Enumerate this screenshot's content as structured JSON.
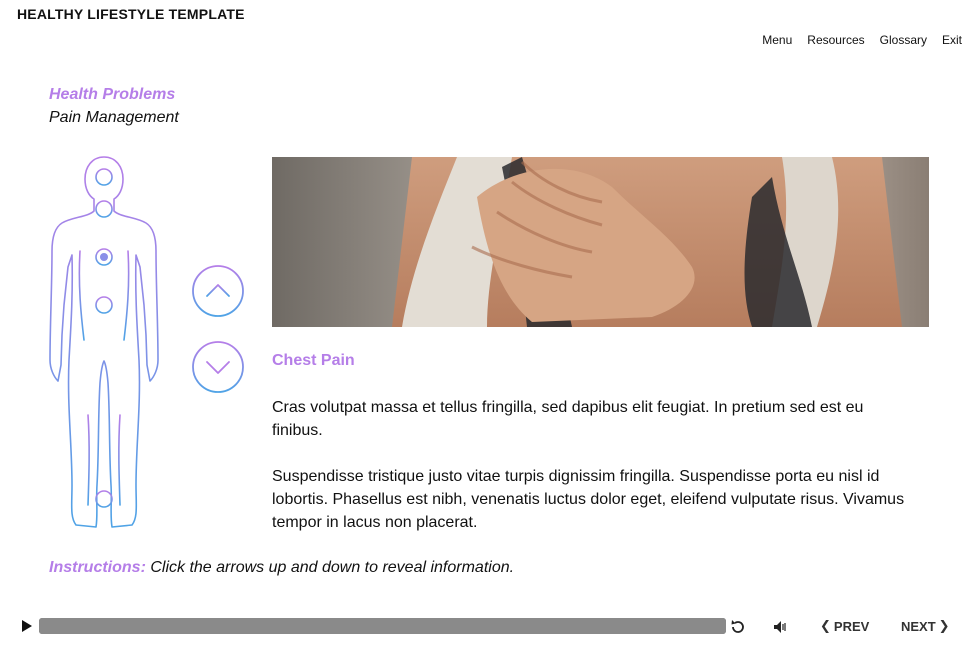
{
  "app": {
    "title": "HEALTHY LIFESTYLE TEMPLATE"
  },
  "nav": {
    "items": [
      "Menu",
      "Resources",
      "Glossary",
      "Exit"
    ]
  },
  "section": {
    "title": "Health Problems",
    "subtitle": "Pain Management"
  },
  "content": {
    "title": "Chest Pain",
    "paragraphs": [
      "Cras volutpat massa et tellus fringilla, sed dapibus elit feugiat. In pretium sed est eu finibus.",
      "Suspendisse tristique justo vitae turpis dignissim fringilla. Suspendisse porta eu nisl id lobortis. Phasellus est nibh, venenatis luctus dolor eget, eleifend vulputate risus. Vivamus tempor in lacus non placerat."
    ]
  },
  "instructions": {
    "lead": "Instructions:",
    "text": " Click the arrows up and down to reveal information."
  },
  "player": {
    "prev_label": "PREV",
    "next_label": "NEXT",
    "progress": 1.0
  },
  "icons": [
    "body-outline-icon",
    "chevron-up-icon",
    "chevron-down-icon",
    "play-icon",
    "replay-icon",
    "volume-icon",
    "chevron-left-icon",
    "chevron-right-icon"
  ],
  "colors": {
    "accent": "#b57ee8",
    "gradient_top": "#b57ee8",
    "gradient_bottom": "#4fa3e6",
    "progress_bar": "#8a8a8a"
  }
}
